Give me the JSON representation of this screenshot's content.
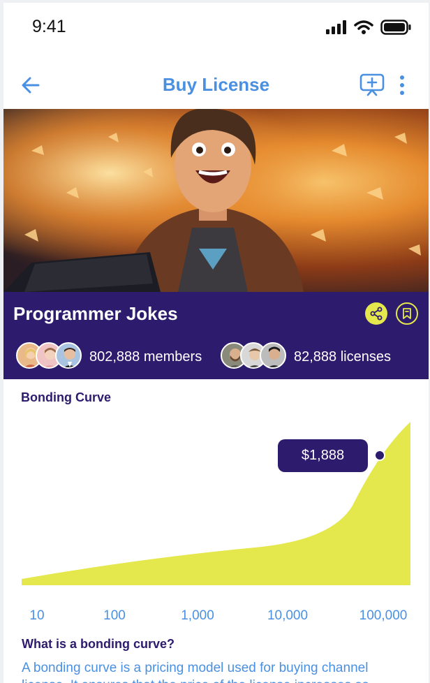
{
  "status": {
    "time": "9:41"
  },
  "nav": {
    "title": "Buy License"
  },
  "channel": {
    "title": "Programmer Jokes",
    "members_text": "802,888 members",
    "licenses_text": "82,888 licenses"
  },
  "bonding": {
    "section_title": "Bonding Curve",
    "price_label": "$1,888",
    "x_ticks": [
      "10",
      "100",
      "1,000",
      "10,000",
      "100,000"
    ]
  },
  "faq": {
    "title": "What is a bonding curve?",
    "body": "A bonding curve is a pricing model used for buying channel license. It ensures that the price of the license increases as"
  },
  "colors": {
    "brand_purple": "#2d1b6e",
    "accent_blue": "#4a90e2",
    "curve_yellow": "#e4e84c"
  },
  "icons": {
    "back": "arrow-left-icon",
    "screen": "screen-add-icon",
    "more": "more-vertical-icon",
    "share": "share-icon",
    "bookmark": "bookmark-icon"
  }
}
